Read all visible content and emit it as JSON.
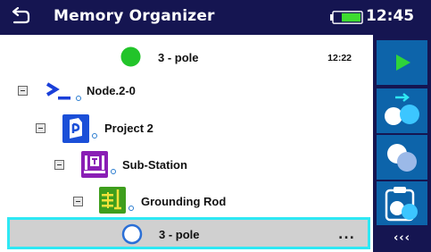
{
  "header": {
    "title": "Memory Organizer",
    "clock": "12:45",
    "back_icon": "return-arrow-icon",
    "battery_icon": "battery-icon"
  },
  "tree": {
    "measurement_top": {
      "label": "3 - pole",
      "time": "12:22",
      "status_color": "#22c42a"
    },
    "node": {
      "label": "Node.2-0",
      "icon": "node-prompt-icon"
    },
    "project": {
      "label": "Project 2",
      "icon": "project-icon"
    },
    "substation": {
      "label": "Sub-Station",
      "icon": "substation-icon"
    },
    "grounding": {
      "label": "Grounding Rod",
      "icon": "grounding-rod-icon"
    },
    "measurement_selected": {
      "label": "3 - pole",
      "more": "...",
      "status_color": "#2a6fd6"
    }
  },
  "sidebar": {
    "buttons": [
      {
        "name": "start-test",
        "icon": "play-icon"
      },
      {
        "name": "add-measurement",
        "icon": "add-measurement-icon"
      },
      {
        "name": "clone-measurement",
        "icon": "clone-icon"
      },
      {
        "name": "paste-measurement",
        "icon": "paste-clipboard-icon"
      }
    ],
    "more_label": "‹‹‹"
  },
  "colors": {
    "header_bg": "#151551",
    "button_bg": "#0d64aa",
    "selection_border": "#2ee8f4",
    "selection_bg": "#d0d0d0"
  }
}
